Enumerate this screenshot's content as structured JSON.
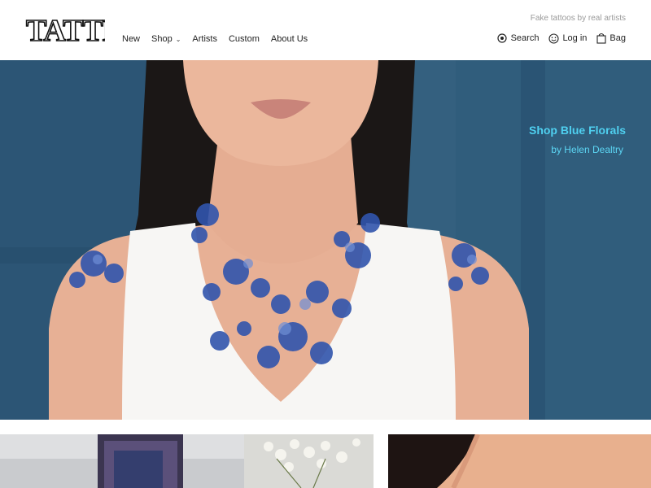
{
  "brand": {
    "logo_text": "TATTLY",
    "tagline": "Fake tattoos by real artists"
  },
  "nav": {
    "items": [
      {
        "label": "New"
      },
      {
        "label": "Shop"
      },
      {
        "label": "Artists"
      },
      {
        "label": "Custom"
      },
      {
        "label": "About Us"
      }
    ]
  },
  "utility": {
    "search_label": "Search",
    "login_label": "Log in",
    "bag_label": "Bag"
  },
  "hero": {
    "title": "Shop Blue Florals",
    "subtitle": "by Helen Dealtry",
    "image_desc": ""
  },
  "colors": {
    "accent": "#4fd0f0",
    "hero_bg": "#33607f",
    "tattoo_blue": "#2f56b0"
  },
  "icons": [
    "search-icon",
    "smiley-icon",
    "bag-icon",
    "chevron-down-icon"
  ]
}
